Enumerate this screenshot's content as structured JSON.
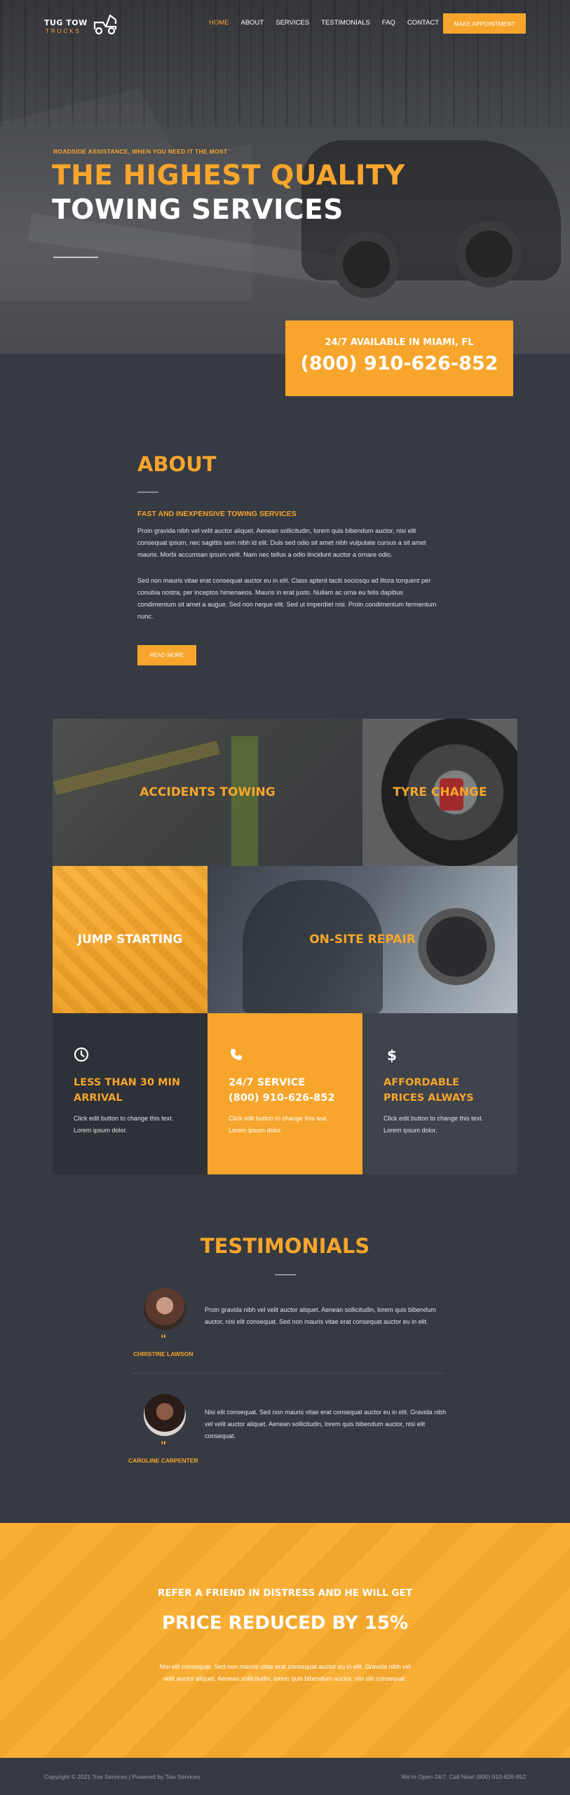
{
  "brand": {
    "name": "TUG TOW",
    "sub": "TRUCKS",
    "accent": "#f7a52c",
    "dark_bg": "#363a42",
    "truck_icon": "tow-truck-icon"
  },
  "nav": {
    "items": [
      "HOME",
      "ABOUT",
      "SERVICES",
      "TESTIMONIALS",
      "FAQ",
      "CONTACT"
    ],
    "active": "HOME",
    "cta": "MAKE APPOINTMENT"
  },
  "hero": {
    "kicker": "ROADSIDE ASSISTANCE, WHEN YOU NEED IT THE MOST",
    "title_line1": "THE HIGHEST QUALITY",
    "title_line2": "TOWING SERVICES"
  },
  "call_box": {
    "prefix": "24/7 AVAILABLE IN",
    "city": "MIAMI, FL",
    "phone": "(800) 910-626-852"
  },
  "about": {
    "title": "ABOUT",
    "subtitle": "FAST AND INEXPENSIVE TOWING SERVICES",
    "p1": "Proin gravida nibh vel velit auctor aliquet. Aenean sollicitudin, lorem quis bibendum auctor, nisi elit consequat ipsum, nec sagittis sem nibh id elit.  Duis sed odio sit amet nibh vulputate cursus a sit amet mauris.  Morbi accumsan ipsum velit.  Nam nec tellus a odio tincidunt auctor a ornare odio.",
    "p2": "Sed non mauris vitae erat consequat auctor eu in elit. Class aptent taciti sociosqu ad litora torquent per conubia nostra, per inceptos himenaeos.  Mauris in erat justo.  Nullam ac urna eu felis dapibus condimentum sit amet a augue. Sed non neque elit. Sed ut imperdiet nisi.  Proin condimentum fermentum nunc.",
    "button": "READ MORE"
  },
  "services": [
    {
      "label": "ACCIDENTS TOWING",
      "color": "#f7a52c"
    },
    {
      "label": "TYRE CHANGE",
      "color": "#f7a52c"
    },
    {
      "label": "JUMP STARTING",
      "color": "#ffffff"
    },
    {
      "label": "ON-SITE REPAIR",
      "color": "#f7a52c"
    }
  ],
  "features": [
    {
      "icon": "clock-icon",
      "title_line1": "LESS THAN 30 MIN",
      "title_line2": "ARRIVAL",
      "text": "Click edit button to change this text. Lorem ipsum dolor."
    },
    {
      "icon": "phone-icon",
      "title_line1": "24/7 SERVICE",
      "title_line2": "(800) 910-626-852",
      "text": "Click edit button to change this text. Lorem ipsum dolor."
    },
    {
      "icon": "dollar-icon",
      "title_line1": "AFFORDABLE",
      "title_line2": "PRICES ALWAYS",
      "text": "Click edit button to change this text. Lorem ipsum dolor."
    }
  ],
  "testimonials": {
    "title": "TESTIMONIALS",
    "items": [
      {
        "name": "CHRISTINE LAWSON",
        "text": "Proin gravida nibh vel velit auctor aliquet. Aenean sollicitudin, lorem quis bibendum auctor, nisi elit consequat. Sed non  mauris vitae erat consequat auctor eu in elit."
      },
      {
        "name": "CAROLINE CARPENTER",
        "text": "Nisi elit consequat. Sed non  mauris vitae erat consequat auctor eu in elit. Gravida nibh vel velit auctor aliquet. Aenean sollicitudin, lorem quis bibendum auctor, nisi elit consequat."
      }
    ]
  },
  "refer": {
    "kicker": "REFER A FRIEND IN DISTRESS AND HE WILL GET",
    "title": "PRICE REDUCED BY 15%",
    "text": "Nisi elit consequat. Sed non mauris vitae erat consequat auctor eu in elit. Gravida nibh vel velit auctor aliquet. Aenean sollicitudin, lorem quis bibendum auctor, nisi elit consequat."
  },
  "footer": {
    "left": "Copyright © 2021 Tow Services  |  Powered by Tow Services",
    "right": "We're Open 24/7. Call  Now! (800) 910-626-852"
  }
}
